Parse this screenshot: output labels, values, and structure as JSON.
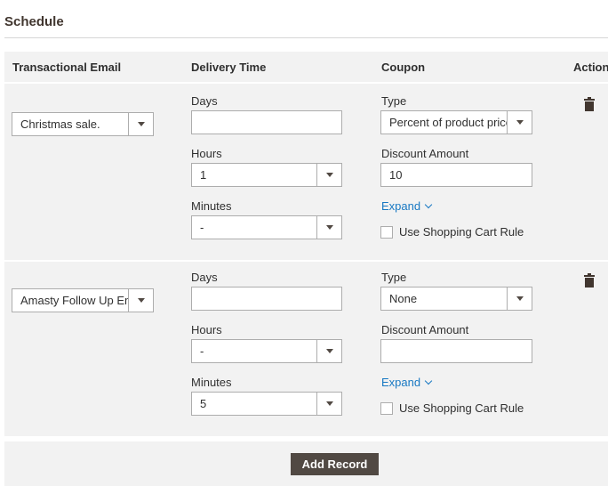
{
  "section": {
    "title": "Schedule"
  },
  "columns": {
    "transactional_email": "Transactional Email",
    "delivery_time": "Delivery Time",
    "coupon": "Coupon",
    "action": "Action"
  },
  "rows": [
    {
      "email": "Christmas sale.",
      "days_label": "Days",
      "days_value": "",
      "hours_label": "Hours",
      "hours_value": "1",
      "minutes_label": "Minutes",
      "minutes_value": "-",
      "type_label": "Type",
      "type_value": "Percent of product price discount",
      "discount_label": "Discount Amount",
      "discount_value": "10",
      "expand_label": "Expand",
      "use_rule_label": "Use Shopping Cart Rule",
      "use_rule_checked": false
    },
    {
      "email": "Amasty Follow Up Email",
      "days_label": "Days",
      "days_value": "",
      "hours_label": "Hours",
      "hours_value": "-",
      "minutes_label": "Minutes",
      "minutes_value": "5",
      "type_label": "Type",
      "type_value": "None",
      "discount_label": "Discount Amount",
      "discount_value": "",
      "expand_label": "Expand",
      "use_rule_label": "Use Shopping Cart Rule",
      "use_rule_checked": false
    }
  ],
  "footer": {
    "add_record_label": "Add Record"
  },
  "icons": {
    "delete": "trash-icon",
    "dropdown": "chevron-down-icon",
    "expand": "chevron-down-icon"
  },
  "colors": {
    "link": "#1979c3",
    "button_bg": "#514943",
    "row_bg": "#f2f2f2"
  }
}
